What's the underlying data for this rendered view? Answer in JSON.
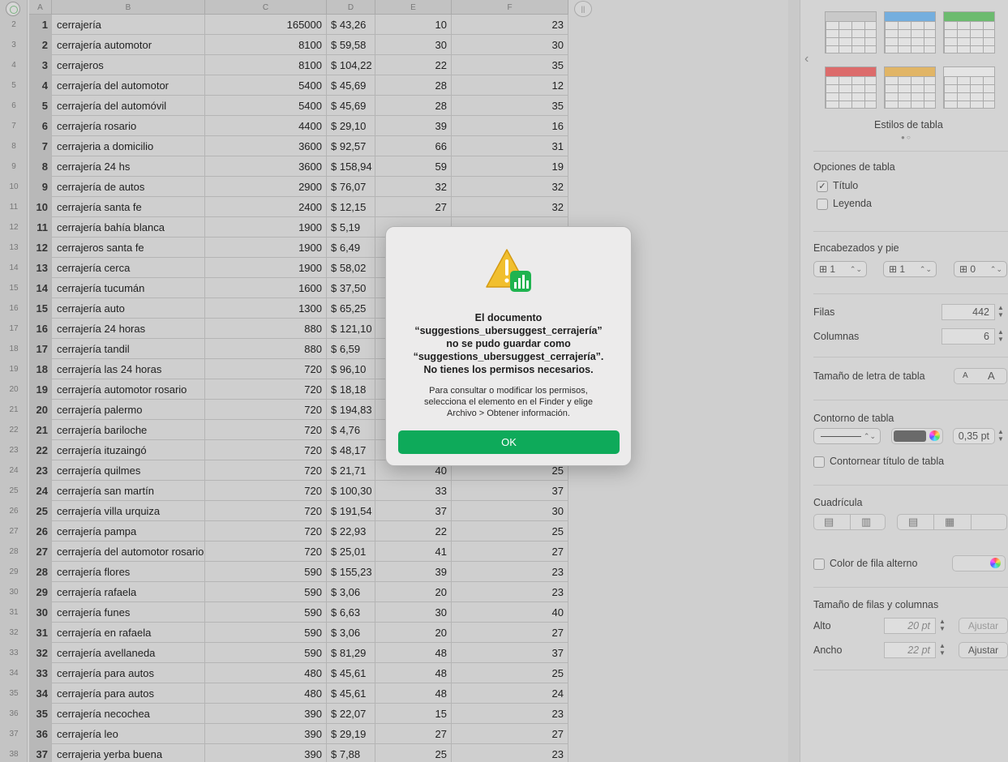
{
  "sheet": {
    "column_letters": [
      "A",
      "B",
      "C",
      "D",
      "E",
      "F"
    ],
    "first_row_number": 2,
    "rows": [
      {
        "n": "1",
        "kw": "cerrajería",
        "vol": "165000",
        "cpc": "$ 43,26",
        "pd": "10",
        "sd": "23"
      },
      {
        "n": "2",
        "kw": "cerrajería automotor",
        "vol": "8100",
        "cpc": "$ 59,58",
        "pd": "30",
        "sd": "30"
      },
      {
        "n": "3",
        "kw": "cerrajeros",
        "vol": "8100",
        "cpc": "$ 104,22",
        "pd": "22",
        "sd": "35"
      },
      {
        "n": "4",
        "kw": "cerrajería del automotor",
        "vol": "5400",
        "cpc": "$ 45,69",
        "pd": "28",
        "sd": "12"
      },
      {
        "n": "5",
        "kw": "cerrajería del automóvil",
        "vol": "5400",
        "cpc": "$ 45,69",
        "pd": "28",
        "sd": "35"
      },
      {
        "n": "6",
        "kw": "cerrajería rosario",
        "vol": "4400",
        "cpc": "$ 29,10",
        "pd": "39",
        "sd": "16"
      },
      {
        "n": "7",
        "kw": "cerrajeria a domicilio",
        "vol": "3600",
        "cpc": "$ 92,57",
        "pd": "66",
        "sd": "31"
      },
      {
        "n": "8",
        "kw": "cerrajería 24 hs",
        "vol": "3600",
        "cpc": "$ 158,94",
        "pd": "59",
        "sd": "19"
      },
      {
        "n": "9",
        "kw": "cerrajería de autos",
        "vol": "2900",
        "cpc": "$ 76,07",
        "pd": "32",
        "sd": "32"
      },
      {
        "n": "10",
        "kw": "cerrajería santa fe",
        "vol": "2400",
        "cpc": "$ 12,15",
        "pd": "27",
        "sd": "32"
      },
      {
        "n": "11",
        "kw": "cerrajería bahía blanca",
        "vol": "1900",
        "cpc": "$ 5,19",
        "pd": "",
        "sd": ""
      },
      {
        "n": "12",
        "kw": "cerrajeros santa fe",
        "vol": "1900",
        "cpc": "$ 6,49",
        "pd": "",
        "sd": ""
      },
      {
        "n": "13",
        "kw": "cerrajería cerca",
        "vol": "1900",
        "cpc": "$ 58,02",
        "pd": "",
        "sd": ""
      },
      {
        "n": "14",
        "kw": "cerrajería tucumán",
        "vol": "1600",
        "cpc": "$ 37,50",
        "pd": "",
        "sd": ""
      },
      {
        "n": "15",
        "kw": "cerrajería auto",
        "vol": "1300",
        "cpc": "$ 65,25",
        "pd": "",
        "sd": ""
      },
      {
        "n": "16",
        "kw": "cerrajería 24 horas",
        "vol": "880",
        "cpc": "$ 121,10",
        "pd": "",
        "sd": ""
      },
      {
        "n": "17",
        "kw": "cerrajería tandil",
        "vol": "880",
        "cpc": "$ 6,59",
        "pd": "",
        "sd": ""
      },
      {
        "n": "18",
        "kw": "cerrajería las 24 horas",
        "vol": "720",
        "cpc": "$ 96,10",
        "pd": "",
        "sd": ""
      },
      {
        "n": "19",
        "kw": "cerrajería automotor rosario",
        "vol": "720",
        "cpc": "$ 18,18",
        "pd": "",
        "sd": ""
      },
      {
        "n": "20",
        "kw": "cerrajería palermo",
        "vol": "720",
        "cpc": "$ 194,83",
        "pd": "",
        "sd": ""
      },
      {
        "n": "21",
        "kw": "cerrajería bariloche",
        "vol": "720",
        "cpc": "$ 4,76",
        "pd": "",
        "sd": ""
      },
      {
        "n": "22",
        "kw": "cerrajería ituzaingó",
        "vol": "720",
        "cpc": "$ 48,17",
        "pd": "",
        "sd": ""
      },
      {
        "n": "23",
        "kw": "cerrajería quilmes",
        "vol": "720",
        "cpc": "$ 21,71",
        "pd": "40",
        "sd": "25"
      },
      {
        "n": "24",
        "kw": "cerrajería san martín",
        "vol": "720",
        "cpc": "$ 100,30",
        "pd": "33",
        "sd": "37"
      },
      {
        "n": "25",
        "kw": "cerrajería villa urquiza",
        "vol": "720",
        "cpc": "$ 191,54",
        "pd": "37",
        "sd": "30"
      },
      {
        "n": "26",
        "kw": "cerrajería pampa",
        "vol": "720",
        "cpc": "$ 22,93",
        "pd": "22",
        "sd": "25"
      },
      {
        "n": "27",
        "kw": "cerrajería del automotor rosario",
        "vol": "720",
        "cpc": "$ 25,01",
        "pd": "41",
        "sd": "27"
      },
      {
        "n": "28",
        "kw": "cerrajería flores",
        "vol": "590",
        "cpc": "$ 155,23",
        "pd": "39",
        "sd": "23"
      },
      {
        "n": "29",
        "kw": "cerrajería rafaela",
        "vol": "590",
        "cpc": "$ 3,06",
        "pd": "20",
        "sd": "23"
      },
      {
        "n": "30",
        "kw": "cerrajería funes",
        "vol": "590",
        "cpc": "$ 6,63",
        "pd": "30",
        "sd": "40"
      },
      {
        "n": "31",
        "kw": "cerrajería en rafaela",
        "vol": "590",
        "cpc": "$ 3,06",
        "pd": "20",
        "sd": "27"
      },
      {
        "n": "32",
        "kw": "cerrajería avellaneda",
        "vol": "590",
        "cpc": "$ 81,29",
        "pd": "48",
        "sd": "37"
      },
      {
        "n": "33",
        "kw": "cerrajería para autos",
        "vol": "480",
        "cpc": "$ 45,61",
        "pd": "48",
        "sd": "25"
      },
      {
        "n": "34",
        "kw": "cerrajería para autos",
        "vol": "480",
        "cpc": "$ 45,61",
        "pd": "48",
        "sd": "24"
      },
      {
        "n": "35",
        "kw": "cerrajería necochea",
        "vol": "390",
        "cpc": "$ 22,07",
        "pd": "15",
        "sd": "23"
      },
      {
        "n": "36",
        "kw": "cerrajería leo",
        "vol": "390",
        "cpc": "$ 29,19",
        "pd": "27",
        "sd": "27"
      },
      {
        "n": "37",
        "kw": "cerrajeria yerba buena",
        "vol": "390",
        "cpc": "$ 7,88",
        "pd": "25",
        "sd": "23"
      }
    ]
  },
  "inspector": {
    "styles_label": "Estilos de tabla",
    "style_colors": [
      "#c9c9c9",
      "#74aede",
      "#6cbb6f",
      "#dc6b6b",
      "#e1b566",
      "#e4e4e4"
    ],
    "table_options_label": "Opciones de tabla",
    "title_option": "Título",
    "title_checked": true,
    "caption_option": "Leyenda",
    "caption_checked": false,
    "headers_footer_label": "Encabezados y pie",
    "header_rows": "1",
    "header_cols": "1",
    "footer_rows": "0",
    "rows_label": "Filas",
    "rows_value": "442",
    "cols_label": "Columnas",
    "cols_value": "6",
    "font_size_label": "Tamaño de letra de tabla",
    "font_small": "A",
    "font_large": "A",
    "outline_label": "Contorno de tabla",
    "outline_width": "0,35 pt",
    "outline_title_option": "Contornear título de tabla",
    "grid_label": "Cuadrícula",
    "alt_row_color_label": "Color de fila alterno",
    "row_col_size_label": "Tamaño de filas y columnas",
    "height_label": "Alto",
    "height_value": "20 pt",
    "width_label": "Ancho",
    "width_value": "22 pt",
    "fit_label": "Ajustar"
  },
  "dialog": {
    "title_lines": [
      "El documento",
      "“suggestions_ubersuggest_cerrajería”",
      "no se pudo guardar como",
      "“suggestions_ubersuggest_cerrajería”.",
      "No tienes los permisos necesarios."
    ],
    "message_lines": [
      "Para consultar o modificar los permisos,",
      "selecciona el elemento en el Finder y elige",
      "Archivo > Obtener información."
    ],
    "ok_label": "OK",
    "ok_color": "#0eaa5a"
  }
}
